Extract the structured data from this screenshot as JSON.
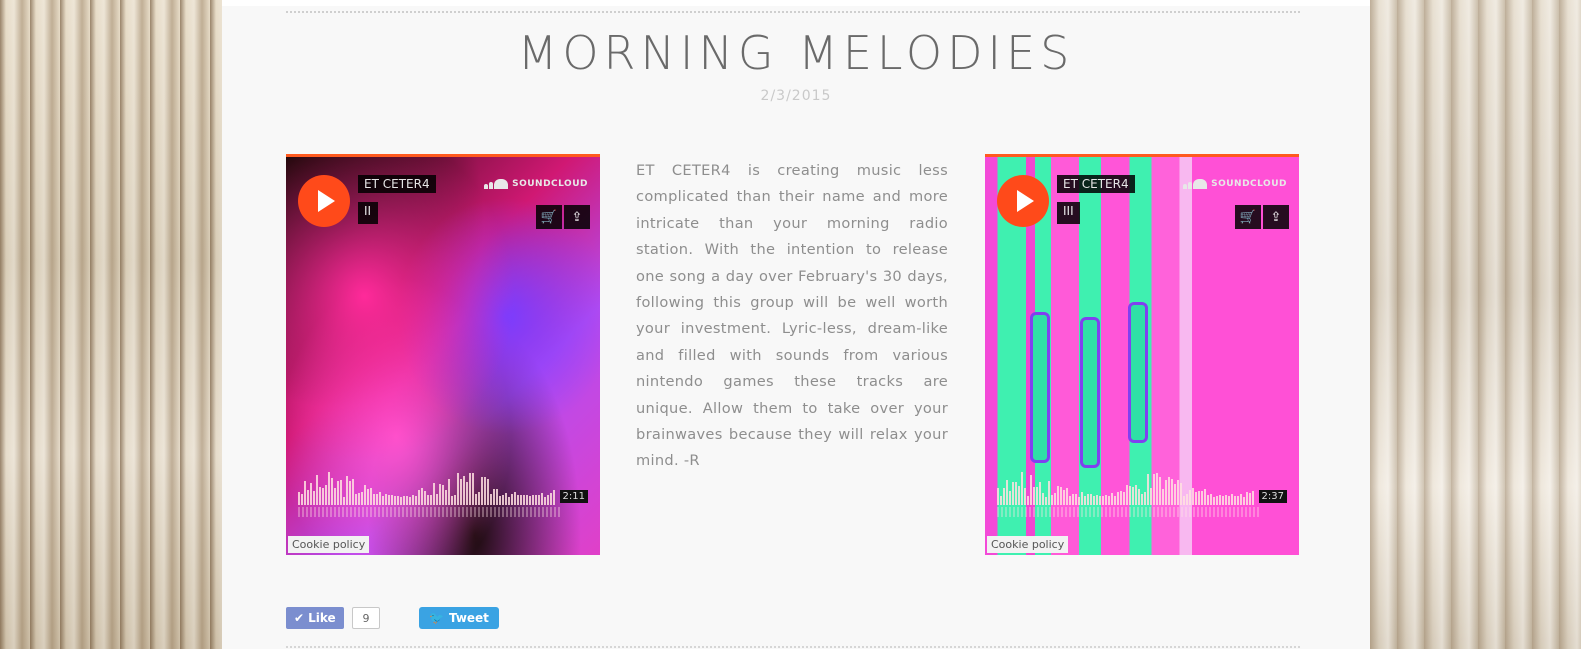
{
  "post": {
    "title": "MORNING MELODIES",
    "date": "2/3/2015",
    "description": "ET CETER4 is creating music less complicated than their name and more intricate than your morning radio station. With the intention to release one song a day over February's 30 days, following this group will be well worth your investment. Lyric-less, dream-like and filled with sounds from various nintendo games these tracks are unique. Allow them to take over your brainwaves because they will relax your mind. -R"
  },
  "players": [
    {
      "artist": "ET CETER4",
      "track": "II",
      "brand": "SOUNDCLOUD",
      "duration": "2:11",
      "cookie": "Cookie policy",
      "accent": "#ff5a1f"
    },
    {
      "artist": "ET CETER4",
      "track": "III",
      "brand": "SOUNDCLOUD",
      "duration": "2:37",
      "cookie": "Cookie policy",
      "accent": "#ff5a1f"
    }
  ],
  "social": {
    "like_label": "Like",
    "like_count": "9",
    "tweet_label": "Tweet",
    "like_color": "#7b8ecf",
    "tweet_color": "#3aa3e3"
  }
}
